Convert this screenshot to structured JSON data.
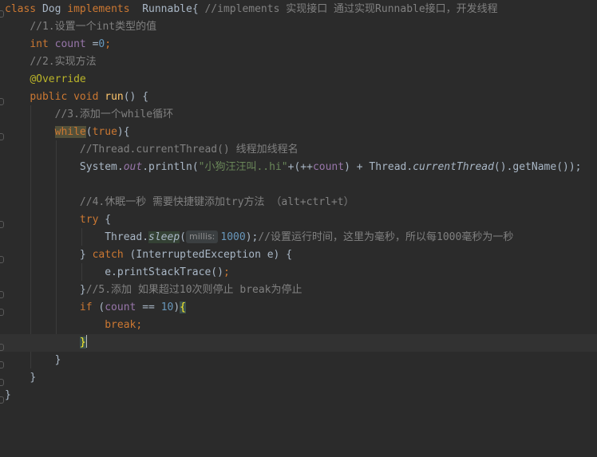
{
  "editor": {
    "lines": [
      {
        "indent": "",
        "t1": "class ",
        "t2": "Dog ",
        "t3": "implements  ",
        "t4": "Runnable{ ",
        "t5": "//implements 实现接口 通过实现Runnable接口，开发线程"
      },
      {
        "indent": "    ",
        "t1": "//1.设置一个int类型的值"
      },
      {
        "indent": "    ",
        "t1": "int ",
        "t2": "count ",
        "t3": "=",
        "t4": "0",
        "t5": ";"
      },
      {
        "indent": "    ",
        "t1": "//2.实现方法"
      },
      {
        "indent": "    ",
        "t1": "@Override"
      },
      {
        "indent": "    ",
        "t1": "public ",
        "t2": "void ",
        "t3": "run",
        "t4": "() {"
      },
      {
        "indent": "        ",
        "t1": "//3.添加一个while循环"
      },
      {
        "indent": "        ",
        "t1": "while",
        "t2": "(",
        "t3": "true",
        "t4": "){"
      },
      {
        "indent": "            ",
        "t1": "//Thread.currentThread() 线程加线程名"
      },
      {
        "indent": "            ",
        "t1": "System.",
        "t2": "out",
        "t3": ".println(",
        "t4": "\"小狗汪汪叫..hi\"",
        "t5": "+(++",
        "t6": "count",
        "t7": ") + Thread.",
        "t8": "currentThread",
        "t9": "().getName());"
      },
      {
        "indent": ""
      },
      {
        "indent": "            ",
        "t1": "//4.休眠一秒 需要快捷键添加try方法 （alt+ctrl+t）"
      },
      {
        "indent": "            ",
        "t1": "try ",
        "t2": "{"
      },
      {
        "indent": "                ",
        "t1": "Thread.",
        "t2": "sleep",
        "t3": "(",
        "hint": "millis:",
        "t4": "1000",
        "t5": ");",
        "t6": "//设置运行时间，这里为毫秒，所以每1000毫秒为一秒"
      },
      {
        "indent": "            ",
        "t1": "} ",
        "t2": "catch ",
        "t3": "(InterruptedException e) {"
      },
      {
        "indent": "                ",
        "t1": "e.printStackTrace()",
        "t2": ";"
      },
      {
        "indent": "            ",
        "t1": "}",
        "t2": "//5.添加 如果超过10次则停止 break为停止"
      },
      {
        "indent": "            ",
        "t1": "if ",
        "t2": "(",
        "t3": "count ",
        "t4": "== ",
        "t5": "10",
        "t6": ")",
        "t7": "{"
      },
      {
        "indent": "                ",
        "t1": "break",
        "t2": ";"
      },
      {
        "indent": "            ",
        "t1": "}"
      },
      {
        "indent": "        ",
        "t1": "}"
      },
      {
        "indent": "    ",
        "t1": "}"
      },
      {
        "indent": "",
        "t1": "}"
      }
    ]
  },
  "colors": {
    "background": "#2b2b2b",
    "keyword": "#cc7832",
    "comment": "#808080",
    "string": "#6a8759",
    "number": "#6897bb",
    "field": "#9876aa",
    "method": "#ffc66d",
    "annotation": "#bbb529",
    "text": "#a9b7c6"
  }
}
